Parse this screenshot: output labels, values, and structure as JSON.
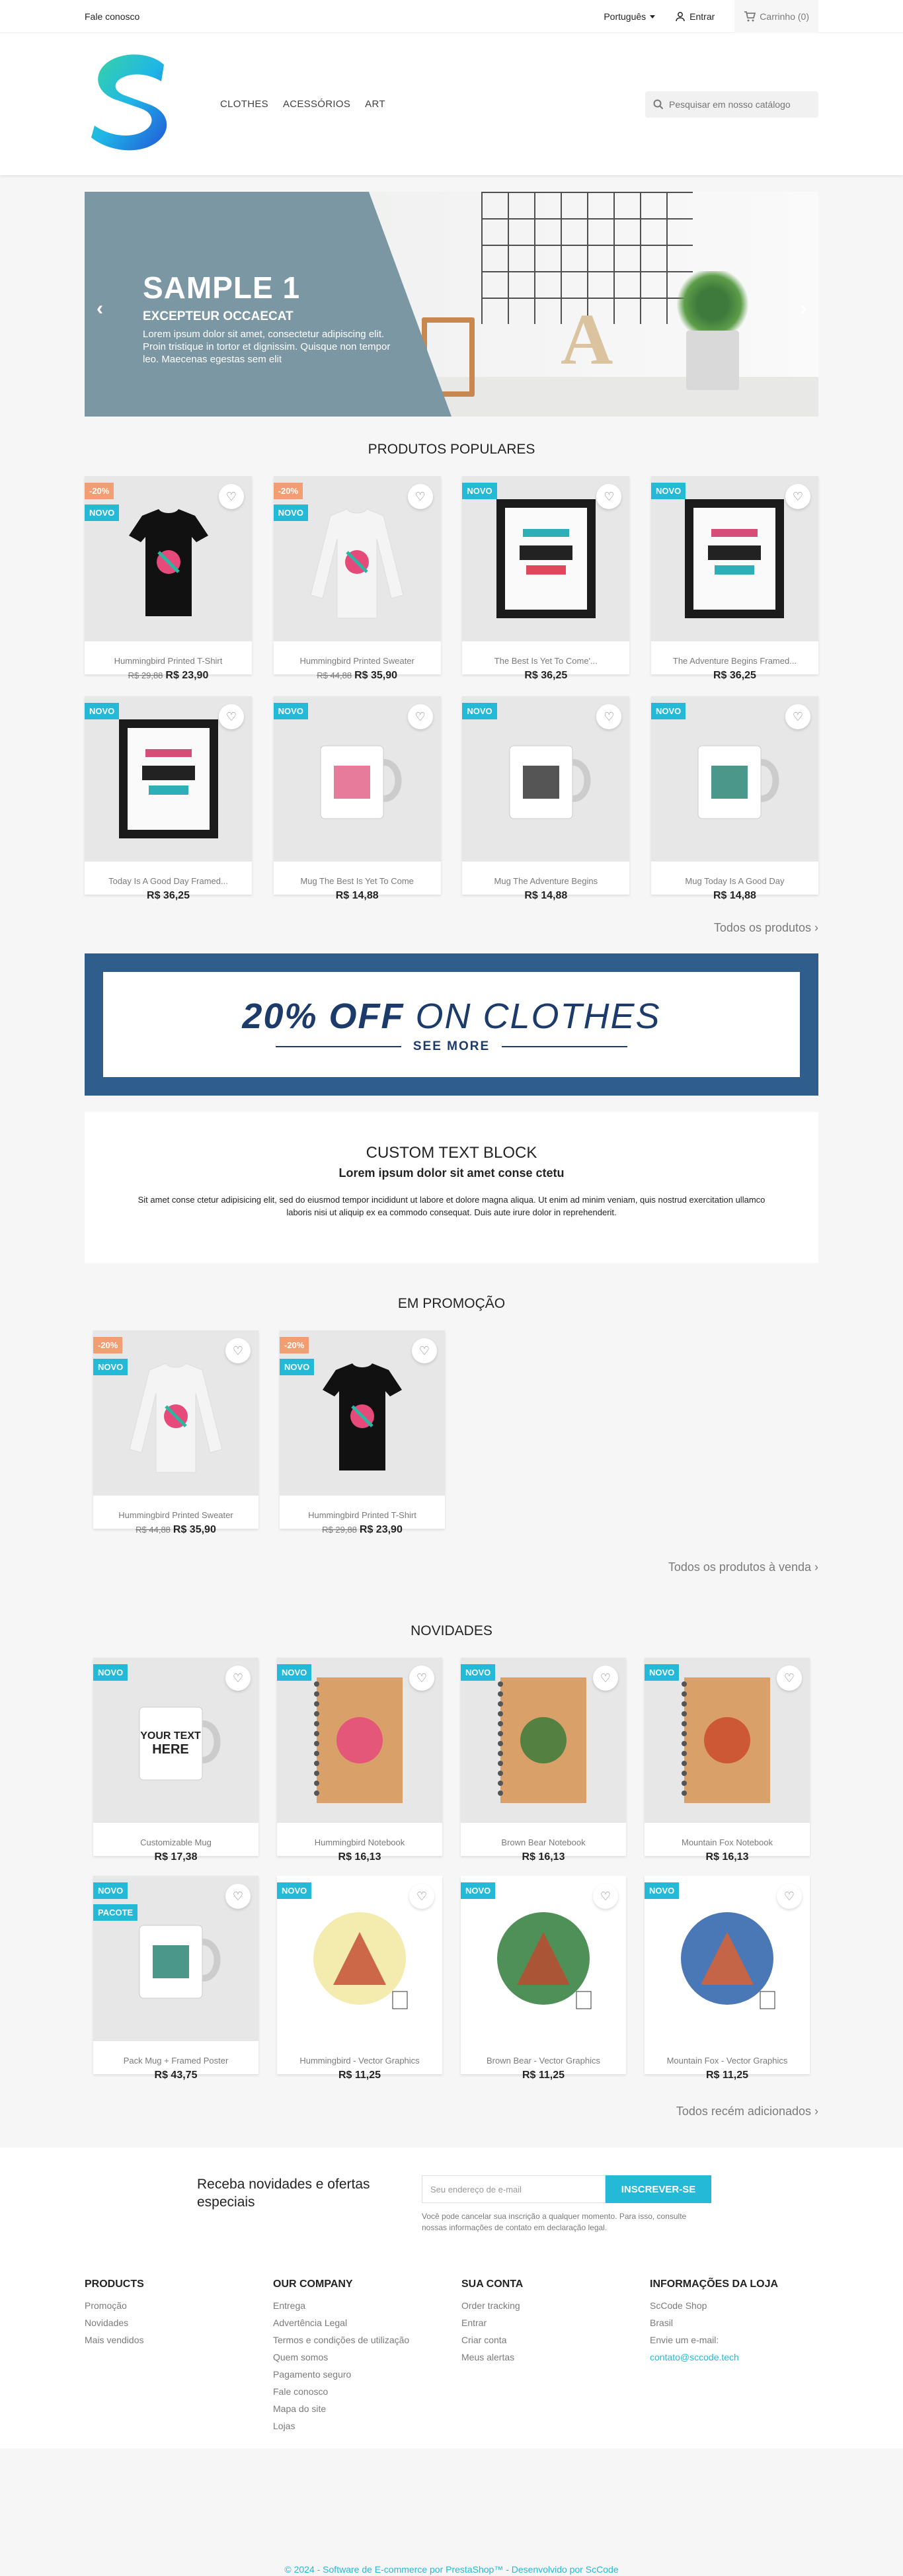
{
  "topbar": {
    "contact": "Fale conosco",
    "language": "Português",
    "signin": "Entrar",
    "cart": "Carrinho (0)"
  },
  "header": {
    "menu": [
      "CLOTHES",
      "ACESSÓRIOS",
      "ART"
    ],
    "search_placeholder": "Pesquisar em nosso catálogo"
  },
  "slider": {
    "title": "SAMPLE 1",
    "subtitle": "EXCEPTEUR OCCAECAT",
    "text": "Lorem ipsum dolor sit amet, consectetur adipiscing elit. Proin tristique in tortor et dignissim. Quisque non tempor leo. Maecenas egestas sem elit"
  },
  "popular": {
    "title": "PRODUTOS POPULARES",
    "all": "Todos os produtos",
    "products": [
      {
        "name": "Hummingbird Printed T-Shirt",
        "old": "R$ 29,88",
        "price": "R$ 23,90",
        "discount": "-20%",
        "new": "NOVO"
      },
      {
        "name": "Hummingbird Printed Sweater",
        "old": "R$ 44,88",
        "price": "R$ 35,90",
        "discount": "-20%",
        "new": "NOVO"
      },
      {
        "name": "The Best Is Yet To Come'...",
        "old": "",
        "price": "R$ 36,25",
        "discount": "",
        "new": "NOVO"
      },
      {
        "name": "The Adventure Begins Framed...",
        "old": "",
        "price": "R$ 36,25",
        "discount": "",
        "new": "NOVO"
      },
      {
        "name": "Today Is A Good Day Framed...",
        "old": "",
        "price": "R$ 36,25",
        "discount": "",
        "new": "NOVO"
      },
      {
        "name": "Mug The Best Is Yet To Come",
        "old": "",
        "price": "R$ 14,88",
        "discount": "",
        "new": "NOVO"
      },
      {
        "name": "Mug The Adventure Begins",
        "old": "",
        "price": "R$ 14,88",
        "discount": "",
        "new": "NOVO"
      },
      {
        "name": "Mug Today Is A Good Day",
        "old": "",
        "price": "R$ 14,88",
        "discount": "",
        "new": "NOVO"
      }
    ]
  },
  "banner": {
    "bold": "20% OFF",
    "rest": "ON CLOTHES",
    "cta": "SEE MORE"
  },
  "customtext": {
    "title": "CUSTOM TEXT BLOCK",
    "subtitle": "Lorem ipsum dolor sit amet conse ctetu",
    "body": "Sit amet conse ctetur adipisicing elit, sed do eiusmod tempor incididunt ut labore et dolore magna aliqua. Ut enim ad minim veniam, quis nostrud exercitation ullamco laboris nisi ut aliquip ex ea commodo consequat. Duis aute irure dolor in reprehenderit."
  },
  "sale": {
    "title": "EM PROMOÇÃO",
    "all": "Todos os produtos à venda",
    "products": [
      {
        "name": "Hummingbird Printed Sweater",
        "old": "R$ 44,88",
        "price": "R$ 35,90",
        "discount": "-20%",
        "new": "NOVO"
      },
      {
        "name": "Hummingbird Printed T-Shirt",
        "old": "R$ 29,88",
        "price": "R$ 23,90",
        "discount": "-20%",
        "new": "NOVO"
      }
    ]
  },
  "newest": {
    "title": "NOVIDADES",
    "all": "Todos recém adicionados",
    "products": [
      {
        "name": "Customizable Mug",
        "price": "R$ 17,38",
        "new": "NOVO",
        "pack": ""
      },
      {
        "name": "Hummingbird Notebook",
        "price": "R$ 16,13",
        "new": "NOVO",
        "pack": ""
      },
      {
        "name": "Brown Bear Notebook",
        "price": "R$ 16,13",
        "new": "NOVO",
        "pack": ""
      },
      {
        "name": "Mountain Fox Notebook",
        "price": "R$ 16,13",
        "new": "NOVO",
        "pack": ""
      },
      {
        "name": "Pack Mug + Framed Poster",
        "price": "R$ 43,75",
        "new": "NOVO",
        "pack": "PACOTE"
      },
      {
        "name": "Hummingbird - Vector Graphics",
        "price": "R$ 11,25",
        "new": "NOVO",
        "pack": ""
      },
      {
        "name": "Brown Bear - Vector Graphics",
        "price": "R$ 11,25",
        "new": "NOVO",
        "pack": ""
      },
      {
        "name": "Mountain Fox - Vector Graphics",
        "price": "R$ 11,25",
        "new": "NOVO",
        "pack": ""
      }
    ]
  },
  "newsletter": {
    "title": "Receba novidades e ofertas especiais",
    "placeholder": "Seu endereço de e-mail",
    "button": "INSCREVER-SE",
    "note": "Você pode cancelar sua inscrição a qualquer momento. Para isso, consulte nossas informações de contato em declaração legal."
  },
  "footer": {
    "products": {
      "title": "PRODUCTS",
      "items": [
        "Promoção",
        "Novidades",
        "Mais vendidos"
      ]
    },
    "company": {
      "title": "OUR COMPANY",
      "items": [
        "Entrega",
        "Advertência Legal",
        "Termos e condições de utilização",
        "Quem somos",
        "Pagamento seguro",
        "Fale conosco",
        "Mapa do site",
        "Lojas"
      ]
    },
    "account": {
      "title": "SUA CONTA",
      "items": [
        "Order tracking",
        "Entrar",
        "Criar conta",
        "Meus alertas"
      ]
    },
    "store": {
      "title": "INFORMAÇÕES DA LOJA",
      "items": [
        "ScCode Shop",
        "Brasil",
        "Envie um e-mail:",
        "contato@sccode.tech"
      ]
    },
    "copyright": "© 2024 - Software de E-commerce por PrestaShop™ - Desenvolvido por ScCode"
  },
  "colors": {
    "accent": "#24b9d7",
    "discount": "#f39d72",
    "banner": "#1c3b6b"
  }
}
